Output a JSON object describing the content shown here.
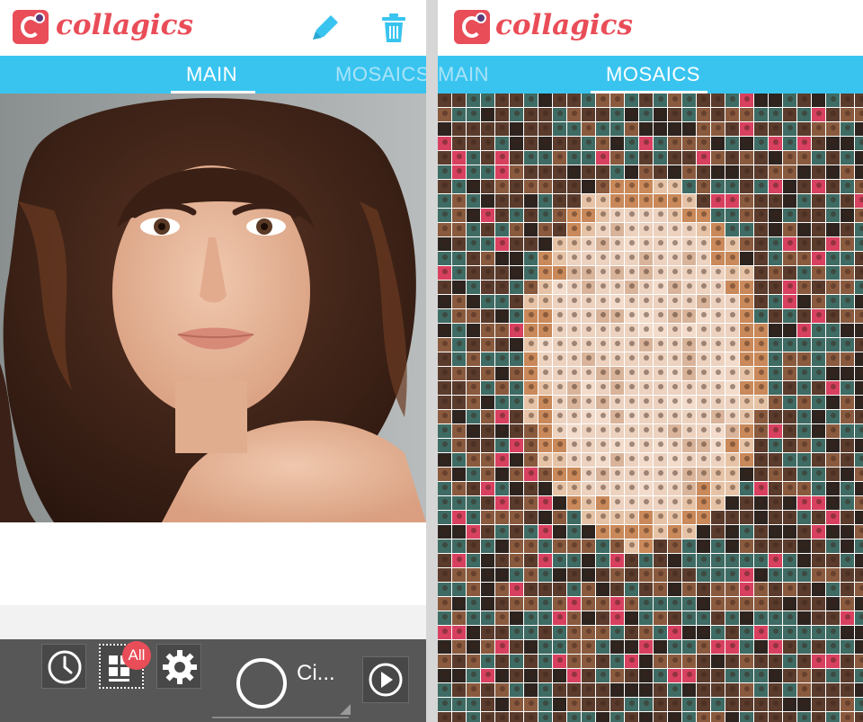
{
  "app": {
    "name": "collagics"
  },
  "left_screen": {
    "tabs": [
      {
        "label": "MAIN",
        "active": true
      },
      {
        "label": "MOSAICS",
        "active": false
      }
    ],
    "header_icons": [
      "pencil-icon",
      "trash-icon"
    ],
    "bottom_bar": {
      "buttons": [
        "clock-icon",
        "grid-icon",
        "gear-icon"
      ],
      "badge": "All",
      "effect_label": "Ci...",
      "play_icon": "play-icon"
    }
  },
  "right_screen": {
    "tabs": [
      {
        "label": "MAIN",
        "active": false
      },
      {
        "label": "MOSAICS",
        "active": true
      }
    ]
  },
  "colors": {
    "brand": "#e94d58",
    "tab_bar": "#39c4f0",
    "bottom_bar": "#575757"
  }
}
